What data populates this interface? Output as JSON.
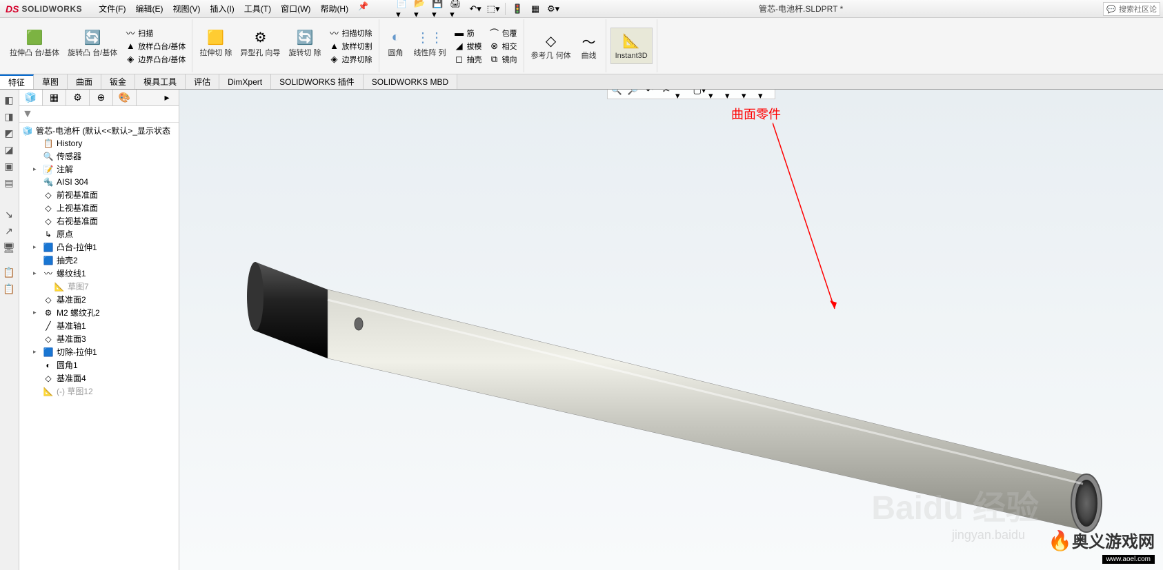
{
  "app": {
    "logo_ds": "DS",
    "logo_text": "SOLIDWORKS"
  },
  "document_title": "管芯-电池杆.SLDPRT *",
  "search_placeholder": "搜索社区论",
  "menus": [
    {
      "label": "文件(F)"
    },
    {
      "label": "编辑(E)"
    },
    {
      "label": "视图(V)"
    },
    {
      "label": "插入(I)"
    },
    {
      "label": "工具(T)"
    },
    {
      "label": "窗口(W)"
    },
    {
      "label": "帮助(H)"
    }
  ],
  "ribbon": {
    "boss_extrude": "拉伸凸\n台/基体",
    "boss_revolve": "旋转凸\n台/基体",
    "sweep": "扫描",
    "loft": "放样凸台/基体",
    "boundary": "边界凸台/基体",
    "cut_extrude": "拉伸切\n除",
    "hole_wizard": "异型孔\n向导",
    "cut_revolve": "旋转切\n除",
    "cut_sweep": "扫描切除",
    "cut_loft": "放样切割",
    "cut_boundary": "边界切除",
    "fillet": "圆角",
    "linear_pattern": "线性阵\n列",
    "rib": "筋",
    "draft": "拔模",
    "shell": "抽壳",
    "wrap": "包覆",
    "intersect": "相交",
    "mirror": "镜向",
    "ref_geom": "参考几\n何体",
    "curves": "曲线",
    "instant3d": "Instant3D"
  },
  "tabs": [
    {
      "label": "特征",
      "active": true
    },
    {
      "label": "草图"
    },
    {
      "label": "曲面"
    },
    {
      "label": "钣金"
    },
    {
      "label": "模具工具"
    },
    {
      "label": "评估"
    },
    {
      "label": "DimXpert"
    },
    {
      "label": "SOLIDWORKS 插件"
    },
    {
      "label": "SOLIDWORKS MBD"
    }
  ],
  "tree": {
    "root": "管芯-电池杆  (默认<<默认>_显示状态",
    "items": [
      {
        "icon": "📋",
        "label": "History"
      },
      {
        "icon": "🔍",
        "label": "传感器"
      },
      {
        "icon": "📝",
        "label": "注解",
        "arrow": true
      },
      {
        "icon": "🔩",
        "label": "AISI 304"
      },
      {
        "icon": "◇",
        "label": "前视基准面"
      },
      {
        "icon": "◇",
        "label": "上视基准面"
      },
      {
        "icon": "◇",
        "label": "右视基准面"
      },
      {
        "icon": "↳",
        "label": "原点"
      },
      {
        "icon": "🟦",
        "label": "凸台-拉伸1",
        "arrow": true
      },
      {
        "icon": "🟦",
        "label": "抽壳2"
      },
      {
        "icon": "〰",
        "label": "螺纹线1",
        "arrow": true
      },
      {
        "icon": "📐",
        "label": "草图7",
        "indent": 2,
        "gray": true
      },
      {
        "icon": "◇",
        "label": "基准面2"
      },
      {
        "icon": "⚙",
        "label": "M2 螺纹孔2",
        "arrow": true
      },
      {
        "icon": "╱",
        "label": "基准轴1"
      },
      {
        "icon": "◇",
        "label": "基准面3"
      },
      {
        "icon": "🟦",
        "label": "切除-拉伸1",
        "arrow": true
      },
      {
        "icon": "◐",
        "label": "圆角1"
      },
      {
        "icon": "◇",
        "label": "基准面4"
      },
      {
        "icon": "📐",
        "label": "(-) 草图12",
        "gray": true
      }
    ]
  },
  "annotation_text": "曲面零件",
  "watermark_main": "Baidu 经验",
  "watermark_sub": "jingyan.baidu",
  "site": {
    "cn": "奥义游戏网",
    "url": "www.aoel.com"
  }
}
